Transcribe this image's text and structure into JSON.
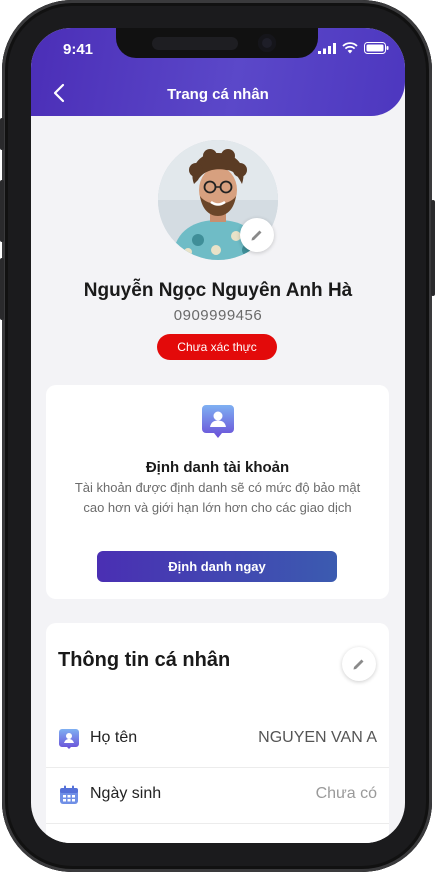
{
  "status": {
    "time": "9:41"
  },
  "header": {
    "title": "Trang cá nhân"
  },
  "profile": {
    "name": "Nguyễn Ngọc Nguyên Anh Hà",
    "phone": "0909999456",
    "verification_status": "Chưa xác thực"
  },
  "identity_card": {
    "title": "Định danh tài khoản",
    "description": "Tài khoản được định danh sẽ có mức độ bảo mật cao hơn và giới hạn lớn hơn cho các giao dịch",
    "button": "Định danh ngay"
  },
  "personal_info": {
    "title": "Thông tin cá nhân",
    "rows": [
      {
        "label": "Họ tên",
        "value": "NGUYEN VAN A",
        "icon": "person-icon"
      },
      {
        "label": "Ngày sinh",
        "value": "Chưa có",
        "icon": "calendar-icon"
      }
    ]
  },
  "colors": {
    "header_start": "#4b2eb7",
    "badge": "#e30a0a",
    "accent": "#6a5ad9"
  }
}
